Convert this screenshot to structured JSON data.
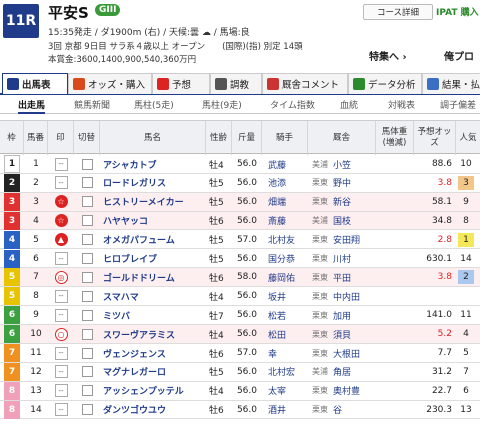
{
  "header": {
    "race_no": "11R",
    "race_name": "平安S",
    "grade": "GIII",
    "info1": "15:35発走 / ダ1900m (右) / 天候:曇 ☁ / 馬場:良",
    "info2": "3回 京都 9日目 サラ系４歳以上 オープン　　(国際)(指) 別定 14頭",
    "info3": "本賞金:3600,1400,900,540,360万円",
    "course_btn": "コース詳細",
    "ipat": "IPAT 購入",
    "special": "特集へ ›",
    "mine": "俺プロ"
  },
  "tabs": [
    {
      "label": "出馬表",
      "icon_color": "#1f3b8a",
      "active": true
    },
    {
      "label": "オッズ・購入",
      "icon_color": "#d84a1b",
      "active": false
    },
    {
      "label": "予想",
      "icon_color": "#d22",
      "active": false
    },
    {
      "label": "調教",
      "icon_color": "#555",
      "active": false
    },
    {
      "label": "厩舎コメント",
      "icon_color": "#c33",
      "active": false
    },
    {
      "label": "データ分析",
      "icon_color": "#2b8a2b",
      "active": false
    },
    {
      "label": "結果・払",
      "icon_color": "#3a6fc4",
      "active": false
    }
  ],
  "subtabs": [
    "出走馬",
    "競馬新聞",
    "馬柱(5走)",
    "馬柱(9走)",
    "タイム指数",
    "血統",
    "対戦表",
    "調子偏差"
  ],
  "columns": {
    "waku": "枠",
    "num": "馬番",
    "mark": "印",
    "cb": "切替",
    "name": "馬名",
    "sex": "性齢",
    "wt": "斤量",
    "jockey": "騎手",
    "stable": "厩舎",
    "body": "馬体重(増減)",
    "odds": "予想オッズ",
    "pop": "人気"
  },
  "rows": [
    {
      "waku": "1",
      "waku_color": "#ffffff",
      "waku_text": "#222",
      "num": "1",
      "mark": "--",
      "name": "アシャカトブ",
      "sex": "牡4",
      "wt": "56.0",
      "jockey": "武藤",
      "region": "美浦",
      "trainer": "小笠",
      "odds": "88.6",
      "red": false,
      "pop": "10",
      "pink": false
    },
    {
      "waku": "2",
      "waku_color": "#222222",
      "waku_text": "#fff",
      "num": "2",
      "mark": "--",
      "name": "ロードレガリス",
      "sex": "牡5",
      "wt": "56.0",
      "jockey": "池添",
      "region": "栗東",
      "trainer": "野中",
      "odds": "3.8",
      "red": true,
      "pop": "3",
      "pink": false
    },
    {
      "waku": "3",
      "waku_color": "#e03030",
      "waku_text": "#fff",
      "num": "3",
      "mark": "☆",
      "name": "ヒストリーメイカー",
      "sex": "牡5",
      "wt": "56.0",
      "jockey": "畑端",
      "region": "栗東",
      "trainer": "新谷",
      "odds": "58.1",
      "red": false,
      "pop": "9",
      "pink": true
    },
    {
      "waku": "3",
      "waku_color": "#e03030",
      "waku_text": "#fff",
      "num": "4",
      "mark": "☆",
      "name": "ハヤヤッコ",
      "sex": "牡6",
      "wt": "56.0",
      "jockey": "斎藤",
      "region": "美浦",
      "trainer": "国枝",
      "odds": "34.8",
      "red": false,
      "pop": "8",
      "pink": true
    },
    {
      "waku": "4",
      "waku_color": "#2a62c4",
      "waku_text": "#fff",
      "num": "5",
      "mark": "▲",
      "name": "オメガパフューム",
      "sex": "牡5",
      "wt": "57.0",
      "jockey": "北村友",
      "region": "栗東",
      "trainer": "安田翔",
      "odds": "2.8",
      "red": true,
      "pop": "1",
      "pink": false
    },
    {
      "waku": "4",
      "waku_color": "#2a62c4",
      "waku_text": "#fff",
      "num": "6",
      "mark": "--",
      "name": "ヒロブレイブ",
      "sex": "牡5",
      "wt": "56.0",
      "jockey": "国分恭",
      "region": "栗東",
      "trainer": "川村",
      "odds": "630.1",
      "red": false,
      "pop": "14",
      "pink": false
    },
    {
      "waku": "5",
      "waku_color": "#e8c300",
      "waku_text": "#fff",
      "num": "7",
      "mark": "◎",
      "name": "ゴールドドリーム",
      "sex": "牡6",
      "wt": "58.0",
      "jockey": "藤岡佑",
      "region": "栗東",
      "trainer": "平田",
      "odds": "3.8",
      "red": true,
      "pop": "2",
      "pink": true
    },
    {
      "waku": "5",
      "waku_color": "#e8c300",
      "waku_text": "#fff",
      "num": "8",
      "mark": "--",
      "name": "スマハマ",
      "sex": "牡4",
      "wt": "56.0",
      "jockey": "坂井",
      "region": "栗東",
      "trainer": "中内田",
      "odds": "",
      "red": false,
      "pop": "",
      "pink": false
    },
    {
      "waku": "6",
      "waku_color": "#3aa040",
      "waku_text": "#fff",
      "num": "9",
      "mark": "--",
      "name": "ミツバ",
      "sex": "牡7",
      "wt": "56.0",
      "jockey": "松若",
      "region": "栗東",
      "trainer": "加用",
      "odds": "141.0",
      "red": false,
      "pop": "11",
      "pink": false
    },
    {
      "waku": "6",
      "waku_color": "#3aa040",
      "waku_text": "#fff",
      "num": "10",
      "mark": "○",
      "name": "スワーヴアラミス",
      "sex": "牡4",
      "wt": "56.0",
      "jockey": "松田",
      "region": "栗東",
      "trainer": "須貝",
      "odds": "5.2",
      "red": true,
      "pop": "4",
      "pink": true
    },
    {
      "waku": "7",
      "waku_color": "#f09020",
      "waku_text": "#fff",
      "num": "11",
      "mark": "--",
      "name": "ヴェンジェンス",
      "sex": "牡6",
      "wt": "57.0",
      "jockey": "幸",
      "region": "栗東",
      "trainer": "大根田",
      "odds": "7.7",
      "red": false,
      "pop": "5",
      "pink": false
    },
    {
      "waku": "7",
      "waku_color": "#f09020",
      "waku_text": "#fff",
      "num": "12",
      "mark": "--",
      "name": "マグナレガーロ",
      "sex": "牡5",
      "wt": "56.0",
      "jockey": "北村宏",
      "region": "美浦",
      "trainer": "角居",
      "odds": "31.2",
      "red": false,
      "pop": "7",
      "pink": false
    },
    {
      "waku": "8",
      "waku_color": "#f0a0b8",
      "waku_text": "#fff",
      "num": "13",
      "mark": "--",
      "name": "アッシェンプッテル",
      "sex": "牡4",
      "wt": "56.0",
      "jockey": "太宰",
      "region": "栗東",
      "trainer": "奥村豊",
      "odds": "22.7",
      "red": false,
      "pop": "6",
      "pink": false
    },
    {
      "waku": "8",
      "waku_color": "#f0a0b8",
      "waku_text": "#fff",
      "num": "14",
      "mark": "--",
      "name": "ダンツゴウユウ",
      "sex": "牡6",
      "wt": "56.0",
      "jockey": "酒井",
      "region": "栗東",
      "trainer": "谷",
      "odds": "230.3",
      "red": false,
      "pop": "13",
      "pink": false
    }
  ]
}
